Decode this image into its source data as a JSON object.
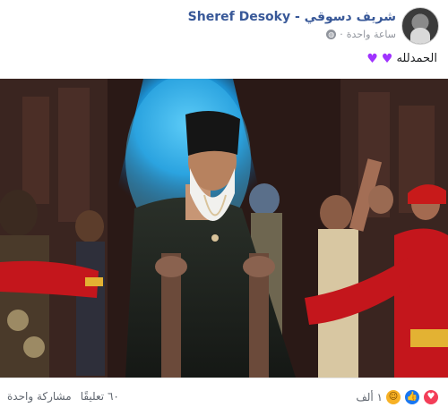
{
  "post": {
    "author": "شريف دسوقي - Sheref Desoky",
    "time": "ساعة واحدة",
    "separator": "·",
    "privacy_icon": "globe-icon",
    "caption_text": "الحمدلله",
    "caption_emojis": [
      "purple-heart",
      "purple-heart"
    ]
  },
  "footer": {
    "reactions_count": "١ ألف",
    "reaction_icons": [
      "love-icon",
      "like-icon",
      "wow-icon"
    ],
    "comments": "٦٠ تعليقًا",
    "shares": "مشاركة واحدة"
  },
  "colors": {
    "author_link": "#385898",
    "heart": "#a033ff",
    "love": "#f33e58",
    "like": "#1877f2",
    "wow": "#f7b125"
  }
}
